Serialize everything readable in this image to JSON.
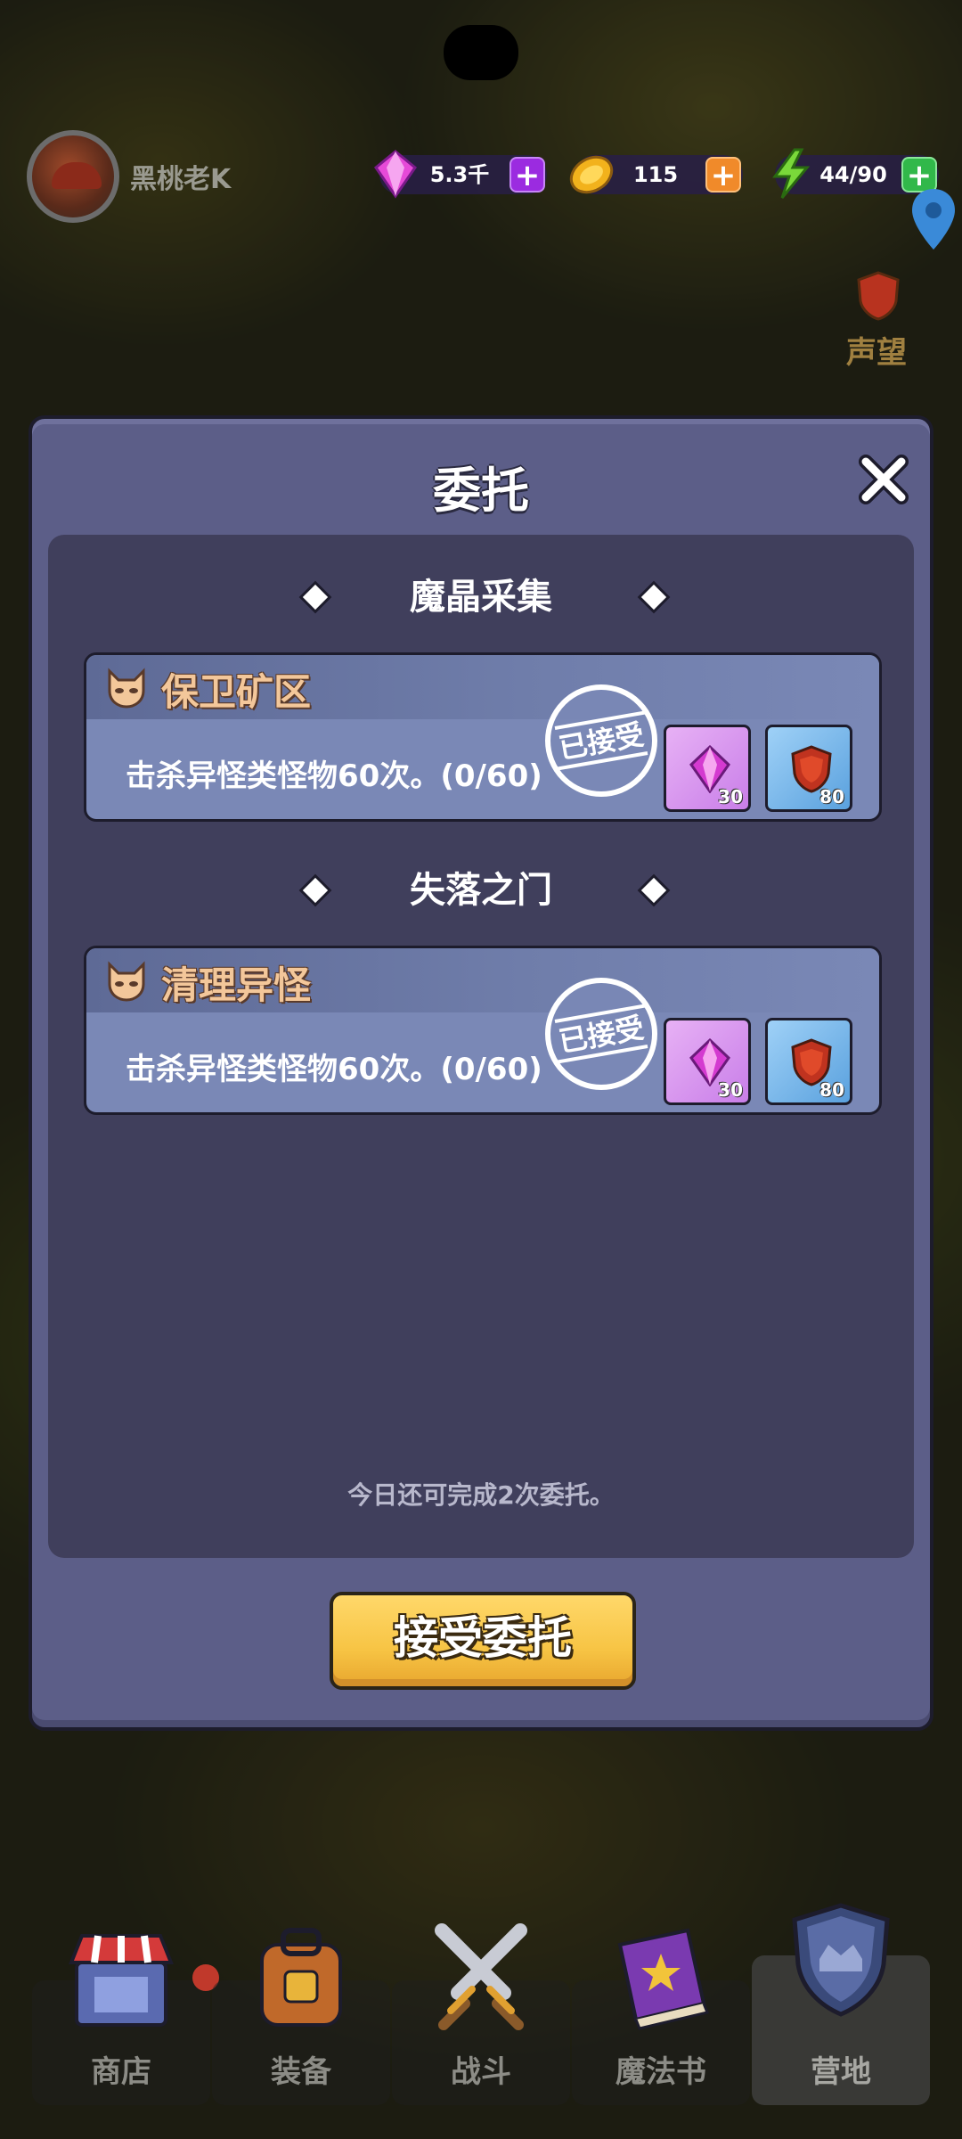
{
  "player": {
    "name": "黑桃老K"
  },
  "resources": {
    "gems": {
      "value": "5.3千",
      "icon": "gem-icon"
    },
    "coins": {
      "value": "115",
      "icon": "coin-icon"
    },
    "energy": {
      "value": "44/90",
      "icon": "lightning-icon"
    }
  },
  "side": {
    "fame_label": "声望"
  },
  "dialog": {
    "title": "委托",
    "sections": [
      {
        "title": "魔晶采集",
        "task": {
          "name": "保卫矿区",
          "description": "击杀异怪类怪物60次。(0/60)",
          "status": "已接受",
          "rewards": [
            {
              "type": "gem",
              "quantity": "30"
            },
            {
              "type": "fame",
              "quantity": "80"
            }
          ]
        }
      },
      {
        "title": "失落之门",
        "task": {
          "name": "清理异怪",
          "description": "击杀异怪类怪物60次。(0/60)",
          "status": "已接受",
          "rewards": [
            {
              "type": "gem",
              "quantity": "30"
            },
            {
              "type": "fame",
              "quantity": "80"
            }
          ]
        }
      }
    ],
    "remaining_text": "今日还可完成2次委托。",
    "accept_button": "接受委托"
  },
  "nav": [
    {
      "label": "商店",
      "icon": "shop-icon"
    },
    {
      "label": "装备",
      "icon": "backpack-icon"
    },
    {
      "label": "战斗",
      "icon": "crossed-swords-icon"
    },
    {
      "label": "魔法书",
      "icon": "spellbook-icon"
    },
    {
      "label": "营地",
      "icon": "camp-shield-icon",
      "active": true
    }
  ],
  "colors": {
    "dialog_bg": "#5c5e88",
    "panel_bg": "#403f5c",
    "card_bg": "#7a88b6",
    "task_name": "#f3c79a",
    "accept_button": "#f7c444"
  }
}
